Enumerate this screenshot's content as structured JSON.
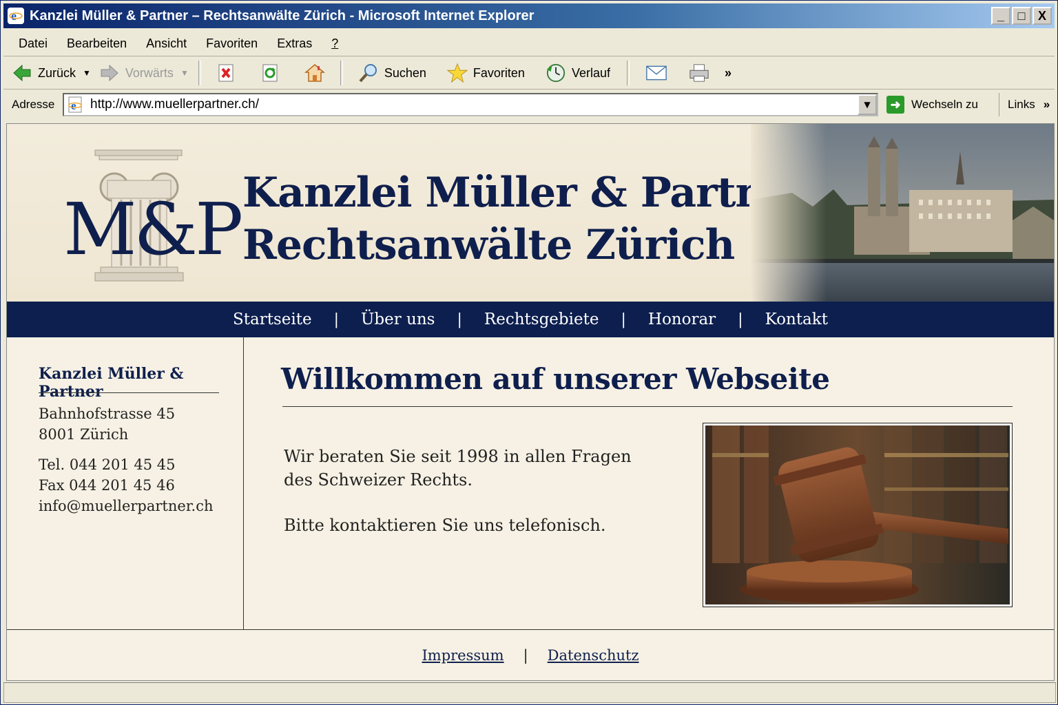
{
  "window": {
    "title": "Kanzlei Müller & Partner – Rechtsanwälte Zürich - Microsoft Internet Explorer",
    "controls": {
      "minimize": "_",
      "maximize": "□",
      "close": "X"
    }
  },
  "menu": [
    "Datei",
    "Bearbeiten",
    "Ansicht",
    "Favoriten",
    "Extras",
    "?"
  ],
  "toolbar": {
    "back": "Zurück",
    "forward": "Vorwärts",
    "search": "Suchen",
    "favorites": "Favoriten",
    "history": "Verlauf",
    "more": "»"
  },
  "address": {
    "label": "Adresse",
    "url": "http://www.muellerpartner.ch/",
    "go": "Wechseln zu",
    "links": "Links",
    "links_more": "»"
  },
  "site": {
    "logo": "M&P",
    "title_line1": "Kanzlei Müller & Partner –",
    "title_line2": "Rechtsanwälte Zürich",
    "nav": [
      "Startseite",
      "Über uns",
      "Rechtsgebiete",
      "Honorar",
      "Kontakt"
    ],
    "nav_sep": "|",
    "sidebar": {
      "name": "Kanzlei Müller & Partner",
      "street": "Bahnhofstrasse 45",
      "city": "8001 Zürich",
      "tel": "Tel. 044 201 45 45",
      "fax": "Fax 044 201 45 46",
      "email": "info@muellerpartner.ch"
    },
    "main": {
      "heading": "Willkommen auf unserer Webseite",
      "para1_line1": "Wir beraten Sie seit 1998 in allen Fragen",
      "para1_line2": "des Schweizer Rechts.",
      "para2": "Bitte kontaktieren Sie uns telefonisch."
    },
    "footer": {
      "impressum": "Impressum",
      "sep": "|",
      "datenschutz": "Datenschutz"
    }
  },
  "colors": {
    "navy": "#0d1f4f",
    "cream": "#f6f1e4",
    "title_bar": "#0a246a"
  }
}
